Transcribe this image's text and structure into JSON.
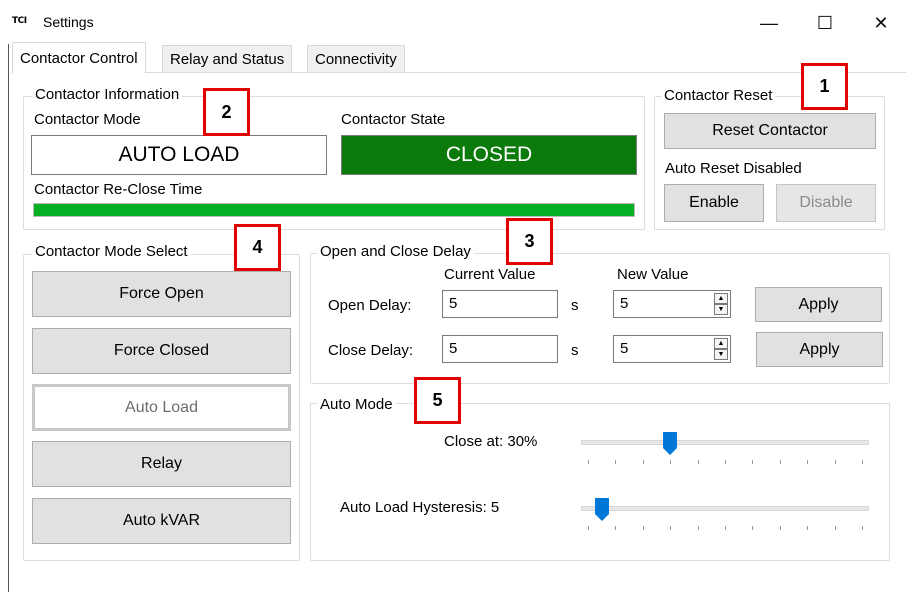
{
  "window": {
    "app_icon_text": "TCI",
    "title": "Settings",
    "minimize": "—",
    "maximize": "☐",
    "close": "✕"
  },
  "tabs": [
    "Contactor Control",
    "Relay and Status",
    "Connectivity"
  ],
  "contactor_info": {
    "legend": "Contactor Information",
    "mode_label": "Contactor Mode",
    "mode_value": "AUTO LOAD",
    "state_label": "Contactor State",
    "state_value": "CLOSED",
    "reclose_label": "Contactor Re-Close Time",
    "reclose_progress": 1.0
  },
  "contactor_reset": {
    "legend": "Contactor Reset",
    "reset_button": "Reset Contactor",
    "auto_reset_status": "Auto Reset Disabled",
    "enable_button": "Enable",
    "disable_button": "Disable"
  },
  "mode_select": {
    "legend": "Contactor Mode Select",
    "buttons": [
      "Force Open",
      "Force Closed",
      "Auto Load",
      "Relay",
      "Auto kVAR"
    ]
  },
  "delay": {
    "legend": "Open and Close Delay",
    "current_header": "Current Value",
    "new_header": "New Value",
    "rows": [
      {
        "label": "Open Delay:",
        "current": "5",
        "unit": "s",
        "new": "5",
        "apply": "Apply"
      },
      {
        "label": "Close Delay:",
        "current": "5",
        "unit": "s",
        "new": "5",
        "apply": "Apply"
      }
    ]
  },
  "auto_mode": {
    "legend": "Auto Mode",
    "close_at_label": "Close at: 30%",
    "close_at_value": 30,
    "hysteresis_label": "Auto Load Hysteresis: 5",
    "hysteresis_value": 5
  },
  "markers": [
    "1",
    "2",
    "3",
    "4",
    "5"
  ],
  "colors": {
    "closed_state": "#0a7a0a",
    "progress": "#06b025",
    "slider_thumb": "#0078d7",
    "marker_border": "#e30000"
  }
}
